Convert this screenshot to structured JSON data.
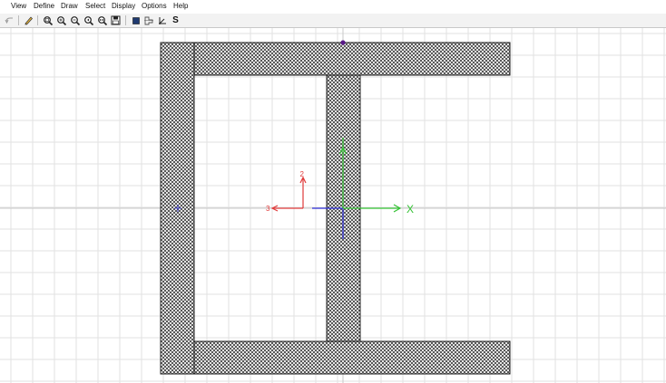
{
  "menu": {
    "items": [
      "View",
      "Define",
      "Draw",
      "Select",
      "Display",
      "Options",
      "Help"
    ]
  },
  "toolbar": {
    "icons": [
      "undo-icon",
      "pencil-icon",
      "zoom-window-icon",
      "zoom-in-icon",
      "zoom-out-icon",
      "zoom-previous-icon",
      "zoom-fit-icon",
      "save-view-icon",
      "filled-shape-icon",
      "section-outline-icon",
      "axes-icon",
      "snap-s-icon"
    ],
    "snap_label": "S"
  },
  "canvas": {
    "local_axis_2_label": "2",
    "local_axis_3_label": "3",
    "global_axis_x_label": "X",
    "colors": {
      "grid": "#e2e2e2",
      "section_fill_hatch": "#1e1e1e",
      "axis_red": "#e03a3a",
      "axis_green": "#33c233",
      "axis_blue": "#2b2bd6",
      "centroid_dot": "#5a1a8a"
    }
  }
}
